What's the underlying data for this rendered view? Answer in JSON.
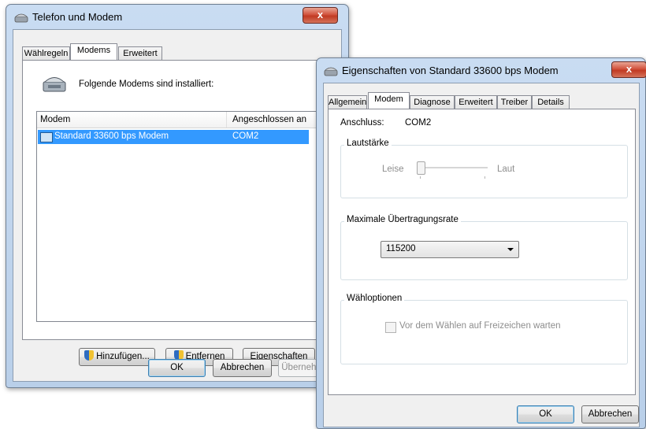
{
  "main_window": {
    "title": "Telefon und Modem",
    "close_glyph": "x",
    "tabs": [
      "Wählregeln",
      "Modems",
      "Erweitert"
    ],
    "header_text": "Folgende Modems sind installiert:",
    "columns": [
      "Modem",
      "Angeschlossen an"
    ],
    "rows": [
      {
        "modem": "Standard 33600 bps Modem",
        "port": "COM2"
      }
    ],
    "buttons": {
      "add": "Hinzufügen...",
      "remove": "Entfernen",
      "properties": "Eigenschaften",
      "ok": "OK",
      "cancel": "Abbrechen",
      "apply": "Übernehmen"
    }
  },
  "props_window": {
    "title": "Eigenschaften von Standard 33600 bps Modem",
    "close_glyph": "x",
    "tabs": [
      "Allgemein",
      "Modem",
      "Diagnose",
      "Erweitert",
      "Treiber",
      "Details"
    ],
    "port_label": "Anschluss:",
    "port_value": "COM2",
    "volume": {
      "group_label": "Lautstärke",
      "low_label": "Leise",
      "high_label": "Laut",
      "level_fraction": 0.0
    },
    "speed": {
      "group_label": "Maximale Übertragungsrate",
      "selected": "115200"
    },
    "dial": {
      "group_label": "Wähloptionen",
      "checkbox_label": "Vor dem Wählen auf Freizeichen warten",
      "checked": false
    },
    "buttons": {
      "ok": "OK",
      "cancel": "Abbrechen"
    }
  }
}
